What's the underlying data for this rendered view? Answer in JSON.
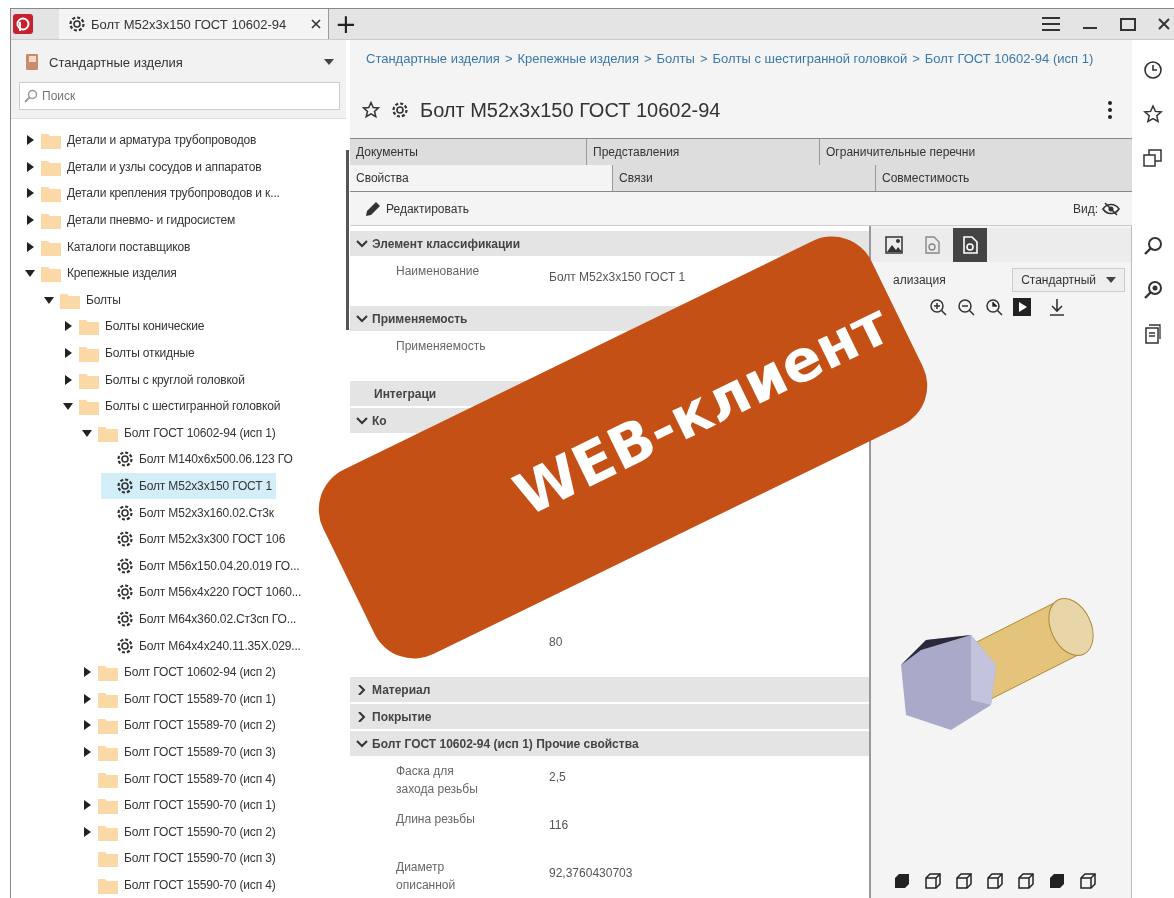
{
  "app": {
    "tab_title": "Болт M52x3x150 ГОСТ 10602-94",
    "new_tab": "+"
  },
  "library": {
    "title": "Стандартные изделия",
    "search": {
      "placeholder": "Поиск"
    }
  },
  "tree": [
    {
      "kind": "folder",
      "label": "Детали и арматура трубопроводов",
      "expanded": false,
      "selected": false
    },
    {
      "kind": "folder",
      "label": "Детали и узлы сосудов и аппаратов",
      "expanded": false,
      "selected": false
    },
    {
      "kind": "folder",
      "label": "Детали крепления трубопроводов и к...",
      "expanded": false,
      "selected": false
    },
    {
      "kind": "folder",
      "label": "Детали пневмо- и гидросистем",
      "expanded": false,
      "selected": false
    },
    {
      "kind": "folder",
      "label": "Каталоги поставщиков",
      "expanded": false,
      "selected": false
    },
    {
      "kind": "folder",
      "label": "Крепежные изделия",
      "expanded": true,
      "selected": false,
      "children": [
        {
          "kind": "folder",
          "label": "Болты",
          "expanded": true,
          "selected": false,
          "children": [
            {
              "kind": "folder",
              "label": "Болты конические",
              "expanded": false,
              "selected": false
            },
            {
              "kind": "folder",
              "label": "Болты откидные",
              "expanded": false,
              "selected": false
            },
            {
              "kind": "folder",
              "label": "Болты с круглой головкой",
              "expanded": false,
              "selected": false
            },
            {
              "kind": "folder",
              "label": "Болты с шестигранной головкой",
              "expanded": true,
              "selected": false,
              "children": [
                {
                  "kind": "folder",
                  "label": "Болт ГОСТ 10602-94 (исп 1)",
                  "expanded": true,
                  "selected": false,
                  "children": [
                    {
                      "kind": "part",
                      "label": "Болт M140x6x500.06.123 ГО",
                      "selected": false
                    },
                    {
                      "kind": "part",
                      "label": "Болт M52x3x150 ГОСТ 1",
                      "selected": true
                    },
                    {
                      "kind": "part",
                      "label": "Болт M52x3x160.02.Ст3к",
                      "selected": false
                    },
                    {
                      "kind": "part",
                      "label": "Болт M52x3x300 ГОСТ 106",
                      "selected": false
                    },
                    {
                      "kind": "part",
                      "label": "Болт M56x150.04.20.019 ГО...",
                      "selected": false
                    },
                    {
                      "kind": "part",
                      "label": "Болт M56x4x220 ГОСТ 1060...",
                      "selected": false
                    },
                    {
                      "kind": "part",
                      "label": "Болт M64x360.02.Ст3сп ГО...",
                      "selected": false
                    },
                    {
                      "kind": "part",
                      "label": "Болт M64x4x240.11.35X.029...",
                      "selected": false
                    }
                  ]
                },
                {
                  "kind": "folder",
                  "label": "Болт ГОСТ 10602-94 (исп 2)",
                  "expanded": false,
                  "selected": false
                },
                {
                  "kind": "folder",
                  "label": "Болт ГОСТ 15589-70 (исп 1)",
                  "expanded": false,
                  "selected": false
                },
                {
                  "kind": "folder",
                  "label": "Болт ГОСТ 15589-70 (исп 2)",
                  "expanded": false,
                  "selected": false
                },
                {
                  "kind": "folder",
                  "label": "Болт ГОСТ 15589-70 (исп 3)",
                  "expanded": false,
                  "selected": false
                },
                {
                  "kind": "empty-folder",
                  "label": "Болт ГОСТ 15589-70 (исп 4)",
                  "selected": false
                },
                {
                  "kind": "folder",
                  "label": "Болт ГОСТ 15590-70 (исп 1)",
                  "expanded": false,
                  "selected": false
                },
                {
                  "kind": "folder",
                  "label": "Болт ГОСТ 15590-70 (исп 2)",
                  "expanded": false,
                  "selected": false
                },
                {
                  "kind": "empty-folder",
                  "label": "Болт ГОСТ 15590-70 (исп 3)",
                  "selected": false
                },
                {
                  "kind": "empty-folder",
                  "label": "Болт ГОСТ 15590-70 (исп 4)",
                  "selected": false
                }
              ]
            }
          ]
        }
      ]
    }
  ],
  "breadcrumb": {
    "separator": ">",
    "items": [
      "Стандартные изделия",
      "Крепежные изделия",
      "Болты",
      "Болты с шестигранной головкой",
      "Болт ГОСТ 10602-94 (исп 1)"
    ]
  },
  "title": "Болт M52x3x150 ГОСТ 10602-94",
  "tab_rows": [
    [
      {
        "label": "Документы",
        "selected": false
      },
      {
        "label": "Представления",
        "selected": false
      },
      {
        "label": "Ограничительные перечни",
        "selected": false
      }
    ],
    [
      {
        "label": "Свойства",
        "selected": true
      },
      {
        "label": "Связи",
        "selected": false
      },
      {
        "label": "Совместимость",
        "selected": false
      }
    ]
  ],
  "toolbar": {
    "edit": "Редактировать",
    "view_label": "Вид:"
  },
  "sections": [
    {
      "kind": "group",
      "title": "Элемент классификации",
      "expanded": true,
      "rows": [
        {
          "name": "Наименование",
          "value": "Болт M52x3x150 ГОСТ 1"
        }
      ]
    },
    {
      "kind": "group",
      "title": "Применяемость",
      "expanded": true,
      "rows": [
        {
          "name": "Применяемость"
        }
      ]
    },
    {
      "kind": "header",
      "title": "Интеграци"
    },
    {
      "kind": "group",
      "title": "Ко",
      "expanded": true,
      "rows": [
        {
          "value": "80"
        }
      ]
    },
    {
      "kind": "group",
      "title": "Материал",
      "expanded": false
    },
    {
      "kind": "group",
      "title": "Покрытие",
      "expanded": false
    },
    {
      "kind": "group",
      "title": "Болт ГОСТ 10602-94 (исп 1) Прочие свойства",
      "expanded": true,
      "rows": [
        {
          "name": "Фаска для захода резьбы",
          "value": "2,5"
        },
        {
          "name": "Длина резьбы",
          "value": "116"
        },
        {
          "name": "Диаметр описанной",
          "value": "92,3760430703"
        }
      ]
    }
  ],
  "viewer": {
    "modes": [
      {
        "kind": "image",
        "selected": false
      },
      {
        "kind": "document",
        "selected": false
      },
      {
        "kind": "model",
        "selected": true
      }
    ],
    "visualization_label": "ализация",
    "visualization_select": "Стандартный"
  },
  "banner": {
    "text": "WEB-клиент"
  }
}
